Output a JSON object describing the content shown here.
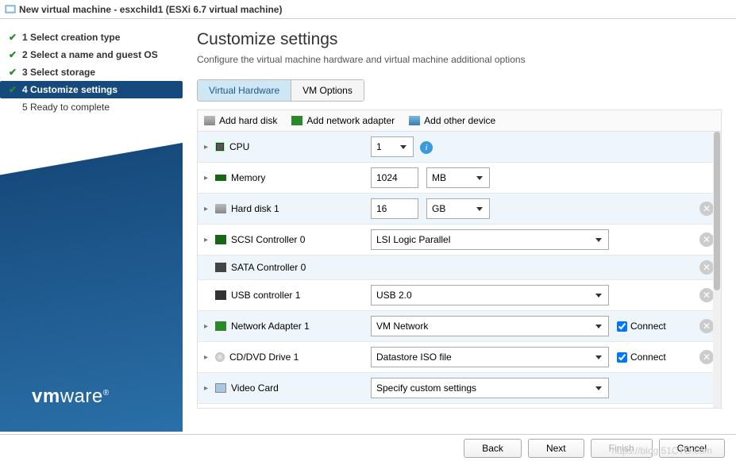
{
  "window": {
    "title": "New virtual machine - esxchild1 (ESXi 6.7 virtual machine)"
  },
  "sidebar": {
    "steps": [
      {
        "label": "1 Select creation type",
        "done": true
      },
      {
        "label": "2 Select a name and guest OS",
        "done": true
      },
      {
        "label": "3 Select storage",
        "done": true
      },
      {
        "label": "4 Customize settings",
        "active": true,
        "done": true
      },
      {
        "label": "5 Ready to complete",
        "pending": true
      }
    ],
    "logo": "vmware"
  },
  "main": {
    "title": "Customize settings",
    "subtitle": "Configure the virtual machine hardware and virtual machine additional options",
    "tabs": {
      "virtual_hardware": "Virtual Hardware",
      "vm_options": "VM Options"
    },
    "devicebar": {
      "add_disk": "Add hard disk",
      "add_net": "Add network adapter",
      "add_other": "Add other device"
    },
    "hardware": {
      "cpu": {
        "label": "CPU",
        "value": "1"
      },
      "memory": {
        "label": "Memory",
        "value": "1024",
        "unit": "MB"
      },
      "disk1": {
        "label": "Hard disk 1",
        "value": "16",
        "unit": "GB"
      },
      "scsi0": {
        "label": "SCSI Controller 0",
        "value": "LSI Logic Parallel"
      },
      "sata0": {
        "label": "SATA Controller 0"
      },
      "usb1": {
        "label": "USB controller 1",
        "value": "USB 2.0"
      },
      "net1": {
        "label": "Network Adapter 1",
        "value": "VM Network",
        "connect": "Connect"
      },
      "cd1": {
        "label": "CD/DVD Drive 1",
        "value": "Datastore ISO file",
        "connect": "Connect"
      },
      "video": {
        "label": "Video Card",
        "value": "Specify custom settings"
      }
    }
  },
  "footer": {
    "back": "Back",
    "next": "Next",
    "finish": "Finish",
    "cancel": "Cancel"
  },
  "watermark": "https://blog.51CTO.com"
}
